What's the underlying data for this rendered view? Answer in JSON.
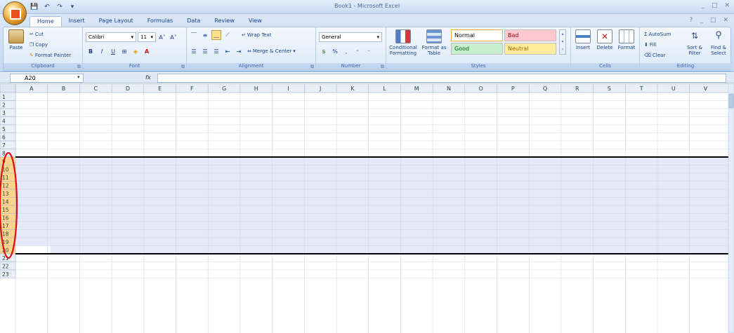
{
  "window": {
    "title": "Book1 - Microsoft Excel",
    "min": "_",
    "max": "□",
    "close": "✕"
  },
  "qat": {
    "save": "💾",
    "undo": "↶",
    "redo": "↷",
    "more": "▾"
  },
  "tabs": [
    "Home",
    "Insert",
    "Page Layout",
    "Formulas",
    "Data",
    "Review",
    "View"
  ],
  "clipboard": {
    "label": "Clipboard",
    "paste": "Paste",
    "cut": "Cut",
    "copy": "Copy",
    "painter": "Format Painter"
  },
  "font": {
    "label": "Font",
    "name": "Calibri",
    "size": "11",
    "bold": "B",
    "italic": "I",
    "underline": "U",
    "grow": "A˄",
    "shrink": "A˅"
  },
  "alignment": {
    "label": "Alignment",
    "wrap": "Wrap Text",
    "merge": "Merge & Center"
  },
  "number": {
    "label": "Number",
    "format": "General",
    "percent": "%",
    "comma": ","
  },
  "styles": {
    "label": "Styles",
    "conditional": "Conditional Formatting",
    "format_table": "Format as Table",
    "normal": "Normal",
    "bad": "Bad",
    "good": "Good",
    "neutral": "Neutral"
  },
  "cells": {
    "label": "Cells",
    "insert": "Insert",
    "delete": "Delete",
    "format": "Format"
  },
  "editing": {
    "label": "Editing",
    "autosum": "AutoSum",
    "fill": "Fill",
    "clear": "Clear",
    "sort": "Sort & Filter",
    "find": "Find & Select"
  },
  "formula_bar": {
    "name_box": "A20",
    "fx": "fx",
    "value": ""
  },
  "sheet": {
    "columns": [
      "A",
      "B",
      "C",
      "D",
      "E",
      "F",
      "G",
      "H",
      "I",
      "J",
      "K",
      "L",
      "M",
      "N",
      "O",
      "P",
      "Q",
      "R",
      "S",
      "T",
      "U",
      "V"
    ],
    "rows": [
      "1",
      "2",
      "3",
      "4",
      "5",
      "6",
      "7",
      "8",
      "9",
      "10",
      "11",
      "12",
      "13",
      "14",
      "15",
      "16",
      "17",
      "18",
      "19",
      "20",
      "21",
      "22",
      "23"
    ],
    "selected_rows": {
      "from": 9,
      "to": 20
    },
    "colors": {
      "selection": "#e5e9f7",
      "header": "#e9eef7",
      "selected_header": "#ffd58c",
      "annotation": "#e01010"
    }
  }
}
